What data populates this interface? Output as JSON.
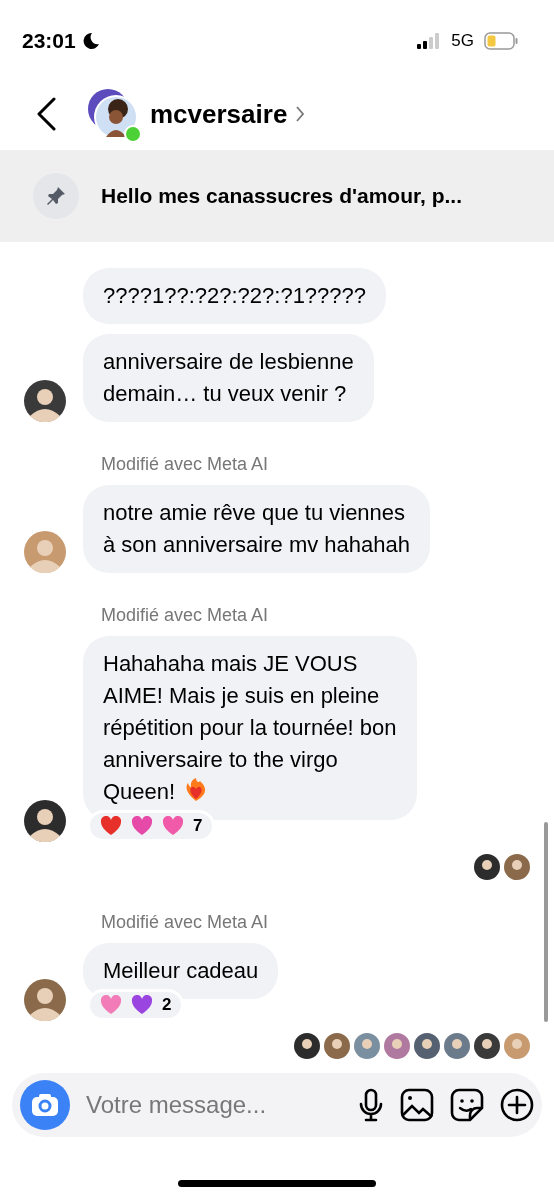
{
  "status_bar": {
    "time": "23:01",
    "network": "5G"
  },
  "header": {
    "username": "mcversaire",
    "online": true
  },
  "pinned": {
    "text": "Hello mes canassucres d'amour, p..."
  },
  "messages": [
    {
      "avatar": false,
      "lines": [
        "????1??:?2?:?2?:?1?????"
      ],
      "emoji_end": false
    },
    {
      "avatar": true,
      "lines": [
        "anniversaire de lesbienne",
        "demain… tu veux venir ?"
      ],
      "emoji_end": false
    },
    {
      "label": "Modifié avec Meta AI",
      "avatar": true,
      "lines": [
        "notre amie rêve que tu viennes",
        "à son anniversaire mv hahahah"
      ],
      "emoji_end": false
    },
    {
      "label": "Modifié avec Meta AI",
      "avatar": true,
      "lines": [
        "Hahahaha mais JE VOUS",
        "AIME! Mais je suis en pleine",
        "répétition pour la tournée! bon",
        "anniversaire to the virgo",
        "Queen!"
      ],
      "emoji_end": true,
      "reactions": [
        {
          "color": "#e8302a"
        },
        {
          "color": "#e64aa8"
        },
        {
          "color": "#f05aa8"
        }
      ],
      "reaction_count": "7",
      "seen_by": [
        {
          "kind": "picture"
        },
        {
          "kind": "picture"
        }
      ]
    },
    {
      "label": "Modifié avec Meta AI",
      "avatar": true,
      "lines": [
        "Meilleur cadeau"
      ],
      "emoji_end": false,
      "reactions": [
        {
          "color": "#f27cb8"
        },
        {
          "color": "#9b45e0"
        }
      ],
      "reaction_count": "2",
      "seen_by": [
        {
          "kind": "picture"
        },
        {
          "kind": "picture"
        },
        {
          "kind": "picture"
        },
        {
          "kind": "picture"
        },
        {
          "kind": "picture"
        },
        {
          "kind": "picture"
        },
        {
          "kind": "picture"
        },
        {
          "kind": "picture"
        }
      ]
    }
  ],
  "composer": {
    "placeholder": "Votre message..."
  }
}
